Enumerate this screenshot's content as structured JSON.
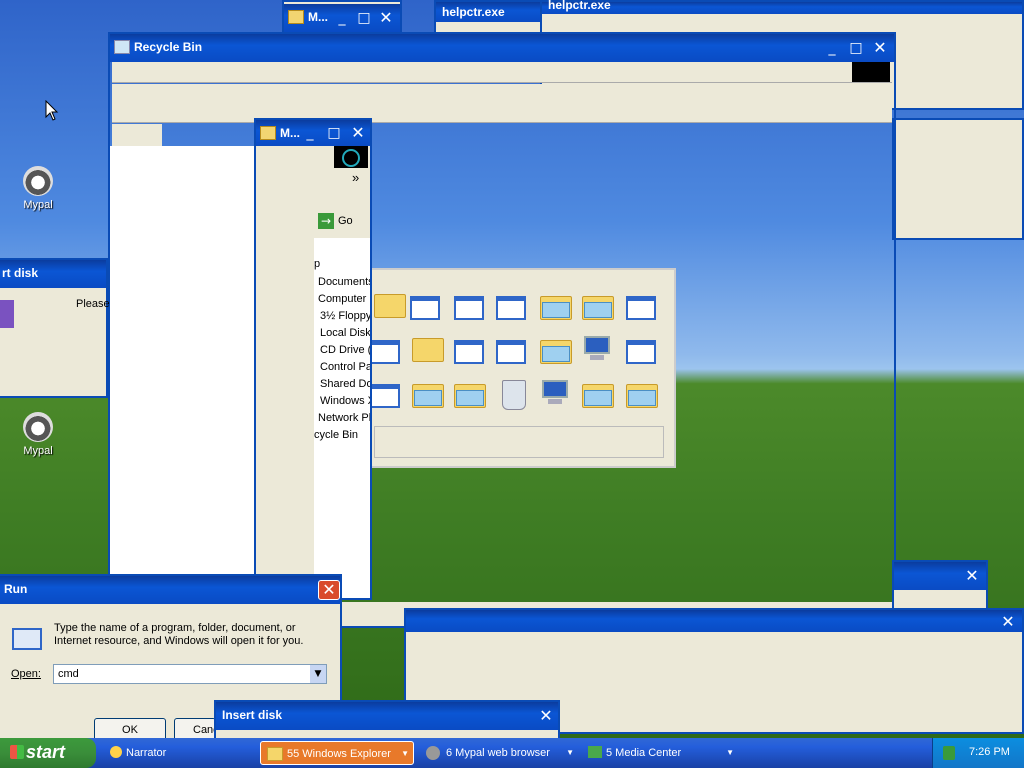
{
  "desktop": {
    "icons": [
      {
        "label": "Mypal",
        "icon": "mypal-raccoon-icon"
      },
      {
        "label": "Mypal",
        "icon": "mypal-raccoon-icon"
      }
    ]
  },
  "windows": {
    "top_small": {
      "title": "M..."
    },
    "helpctr1": {
      "title": "helpctr.exe"
    },
    "helpctr2": {
      "title": "helpctr.exe"
    },
    "recycle_bin": {
      "title": "Recycle Bin"
    },
    "explorer_small": {
      "title": "M...",
      "chevron": "»",
      "go_label": "Go",
      "tree_items": [
        "p",
        "Documents",
        "Computer",
        "3½ Floppy",
        "Local Disk",
        "CD Drive (",
        "Control Pa",
        "Shared Do",
        "Windows X",
        "Network Pl",
        "cycle Bin"
      ]
    },
    "insert_disk_left": {
      "title": "rt disk",
      "message": "Please"
    },
    "run": {
      "title": "Run",
      "description": "Type the name of a program, folder, document, or Internet resource, and Windows will open it for you.",
      "open_label": "Open:",
      "open_value": "cmd",
      "ok_label": "OK",
      "cancel_label": "Canc"
    },
    "insert_disk_bottom": {
      "title": "Insert disk"
    }
  },
  "taskbar": {
    "start_label": "start",
    "tasks": [
      {
        "label": "Narrator",
        "icon": "narrator-icon"
      },
      {
        "label": "55 Windows Explorer",
        "icon": "folder-icon",
        "active": true
      },
      {
        "label": "6 Mypal web browser",
        "icon": "mypal-raccoon-icon"
      },
      {
        "label": "5 Media Center",
        "icon": "media-center-icon"
      }
    ],
    "clock": "7:26 PM"
  },
  "colors": {
    "title_blue": "#0b56d4",
    "start_green": "#3a8e3a",
    "active_task": "#e8792a",
    "close_red": "#d94b2b"
  }
}
